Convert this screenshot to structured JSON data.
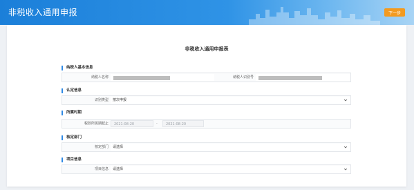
{
  "header": {
    "title": "非税收入通用申报",
    "next_label": "下一步"
  },
  "form": {
    "title": "非税收入通用申报表"
  },
  "sections": {
    "taxpayer": {
      "title": "纳税人基本信息",
      "name_label": "纳税人名称",
      "id_label": "纳税人识别号"
    },
    "identification": {
      "title": "认定信息",
      "type_label": "识别类型",
      "type_value": "按次申报"
    },
    "period": {
      "title": "所属时期",
      "label": "税款所属期起止",
      "start": "2021-08-20",
      "separator": "-",
      "end": "2021-08-20"
    },
    "department": {
      "title": "核定部门",
      "label": "核定部门",
      "value": "请选择"
    },
    "project": {
      "title": "项目信息",
      "label": "项目信息",
      "value": "请选择"
    }
  },
  "icons": {
    "dropdown": "chevron-down-icon"
  },
  "colors": {
    "header": "#2f93e6",
    "next_button": "#f39a1f",
    "section_marker": "#2f8ae5"
  }
}
